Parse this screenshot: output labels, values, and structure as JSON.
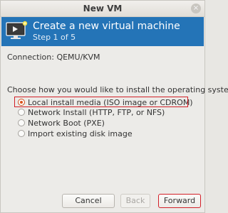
{
  "window": {
    "title": "New VM",
    "close_glyph": "×"
  },
  "banner": {
    "icon": "monitor-icon",
    "title": "Create a new virtual machine",
    "step": "Step 1 of 5",
    "color": "#2474b7"
  },
  "connection": {
    "text": "Connection:  QEMU/KVM"
  },
  "install": {
    "prompt": "Choose how you would like to install the operating system",
    "options": [
      {
        "label": "Local install media (ISO image or CDROM)",
        "selected": true
      },
      {
        "label": "Network Install (HTTP, FTP, or NFS)",
        "selected": false
      },
      {
        "label": "Network Boot (PXE)",
        "selected": false
      },
      {
        "label": "Import existing disk image",
        "selected": false
      }
    ]
  },
  "buttons": {
    "cancel": "Cancel",
    "back": "Back",
    "forward": "Forward"
  }
}
